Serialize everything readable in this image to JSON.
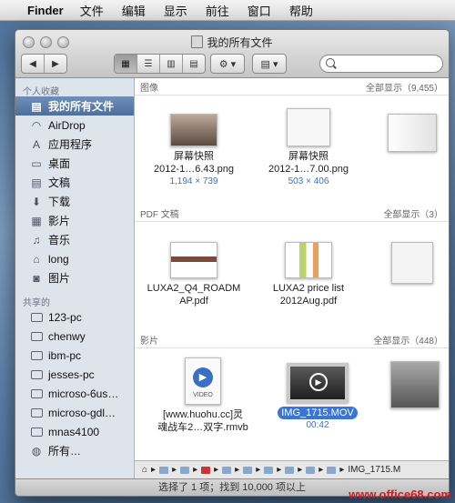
{
  "menubar": {
    "apple": "",
    "app": "Finder",
    "items": [
      "文件",
      "编辑",
      "显示",
      "前往",
      "窗口",
      "帮助"
    ]
  },
  "window": {
    "title": "我的所有文件"
  },
  "sidebar": {
    "favorites_header": "个人收藏",
    "favorites": [
      {
        "label": "我的所有文件",
        "icon": "all-files-icon",
        "glyph": "▤",
        "selected": true
      },
      {
        "label": "AirDrop",
        "icon": "airdrop-icon",
        "glyph": "◠"
      },
      {
        "label": "应用程序",
        "icon": "applications-icon",
        "glyph": "A"
      },
      {
        "label": "桌面",
        "icon": "desktop-icon",
        "glyph": "▭"
      },
      {
        "label": "文稿",
        "icon": "documents-icon",
        "glyph": "▤"
      },
      {
        "label": "下载",
        "icon": "downloads-icon",
        "glyph": "⬇"
      },
      {
        "label": "影片",
        "icon": "movies-icon",
        "glyph": "▦"
      },
      {
        "label": "音乐",
        "icon": "music-icon",
        "glyph": "♫"
      },
      {
        "label": "long",
        "icon": "home-icon",
        "glyph": "⌂"
      },
      {
        "label": "图片",
        "icon": "pictures-icon",
        "glyph": "◙"
      }
    ],
    "shared_header": "共享的",
    "shared": [
      "123-pc",
      "chenwy",
      "ibm-pc",
      "jesses-pc",
      "microso-6us…",
      "microso-gdl…",
      "mnas4100",
      "所有…"
    ]
  },
  "groups": {
    "images": {
      "label": "图像",
      "show_all": "全部显示（9,455）",
      "items": [
        {
          "line1": "屏幕快照",
          "line2": "2012-1…6.43.png",
          "dims": "1,194 × 739"
        },
        {
          "line1": "屏幕快照",
          "line2": "2012-1…7.00.png",
          "dims": "503 × 406"
        }
      ]
    },
    "pdf": {
      "label": "PDF 文稿",
      "show_all": "全部显示（3）",
      "items": [
        {
          "line1": "LUXA2_Q4_ROADM",
          "line2": "AP.pdf"
        },
        {
          "line1": "LUXA2 price list",
          "line2": "2012Aug.pdf"
        }
      ]
    },
    "movies": {
      "label": "影片",
      "show_all": "全部显示（448）",
      "items": [
        {
          "line1": "[www.huohu.cc]灵",
          "line2": "魂战车2…双字.rmvb",
          "badge": "VIDEO"
        },
        {
          "line1": "IMG_1715.MOV",
          "line2": "00:42",
          "selected": true
        }
      ]
    }
  },
  "pathbar": {
    "last": "IMG_1715.M"
  },
  "status": {
    "text": "选择了 1 项；找到 10,000 项以上"
  },
  "watermark": "www.office68.com"
}
